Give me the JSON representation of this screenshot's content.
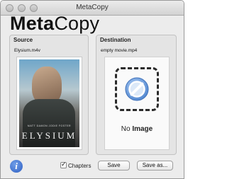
{
  "window": {
    "title": "MetaCopy"
  },
  "logo": {
    "bold": "Meta",
    "regular": "Copy"
  },
  "source": {
    "title": "Source",
    "file": "Elysium.m4v",
    "poster": {
      "cast": "MATT DAMON   JODIE FOSTER",
      "title": "ELYSIUM"
    }
  },
  "destination": {
    "title": "Destination",
    "file": "empty movie.mp4",
    "no_image_prefix": "No",
    "no_image_suffix": "Image"
  },
  "footer": {
    "info_glyph": "i",
    "chapters_label": "Chapters",
    "chapters_checked": true,
    "save_label": "Save",
    "save_as_label": "Save as..."
  },
  "icons": {
    "info": "info-icon",
    "no_image": "prohibited-icon"
  },
  "colors": {
    "accent": "#3b6fd6",
    "prohibited": "#5b8fd6"
  }
}
